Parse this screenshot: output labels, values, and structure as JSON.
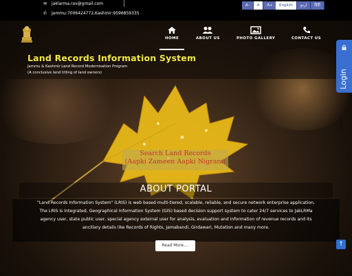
{
  "topbar": {
    "email": "jaklarma.rav@gmail.com",
    "phone": "Jammu:7006424772,Kashmir:9596859335",
    "font_sizes": [
      "A-",
      "A",
      "A+"
    ],
    "languages": [
      "English",
      "اردو",
      "हिंदी"
    ],
    "active_font": "A",
    "active_language": "English"
  },
  "brand": {
    "title": "Land Records Information System",
    "subtitle1": "Jammu & Kashmir Land Record Modernisation Program",
    "subtitle2": "(A conclusive land titling of land owners)"
  },
  "nav": {
    "items": [
      {
        "label": "HOME",
        "icon": "home-icon",
        "active": true
      },
      {
        "label": "ABOUT US",
        "icon": "users-icon",
        "active": false
      },
      {
        "label": "PHOTO GALLERY",
        "icon": "image-icon",
        "active": false
      },
      {
        "label": "CONTACT US",
        "icon": "phone-icon",
        "active": false
      }
    ]
  },
  "login": {
    "label": "Login",
    "icon": "lock-icon"
  },
  "search": {
    "line1": "Search Land Records",
    "line2": "(Aapki Zameen Aapki Nigrani)"
  },
  "about": {
    "title": "ABOUT PORTAL",
    "line1": "\"Land Records Information System\" (LRIS) is web based multi-tiered, scalable, reliable, and secure network enterprise application.",
    "line2": "The LRIS is Integrated, Geographical Information System (GIS) based decision support system to cater 24/7 services to JakLRMa",
    "line3": "agency user, state public user, special agency external user for analysis, evaluation and information of revenue records and its",
    "line4": "ancillary details like Records of Rights, Jamabandi, Girdawari, Mutation and many more.",
    "read_more": "Read More...."
  },
  "scroll_top": {
    "icon": "arrow-up-icon"
  },
  "colors": {
    "brand_title": "#f2e84a",
    "lang_button": "#5b6bb3",
    "login_tab": "#3a6fd1",
    "search_text": "#c0392b"
  }
}
